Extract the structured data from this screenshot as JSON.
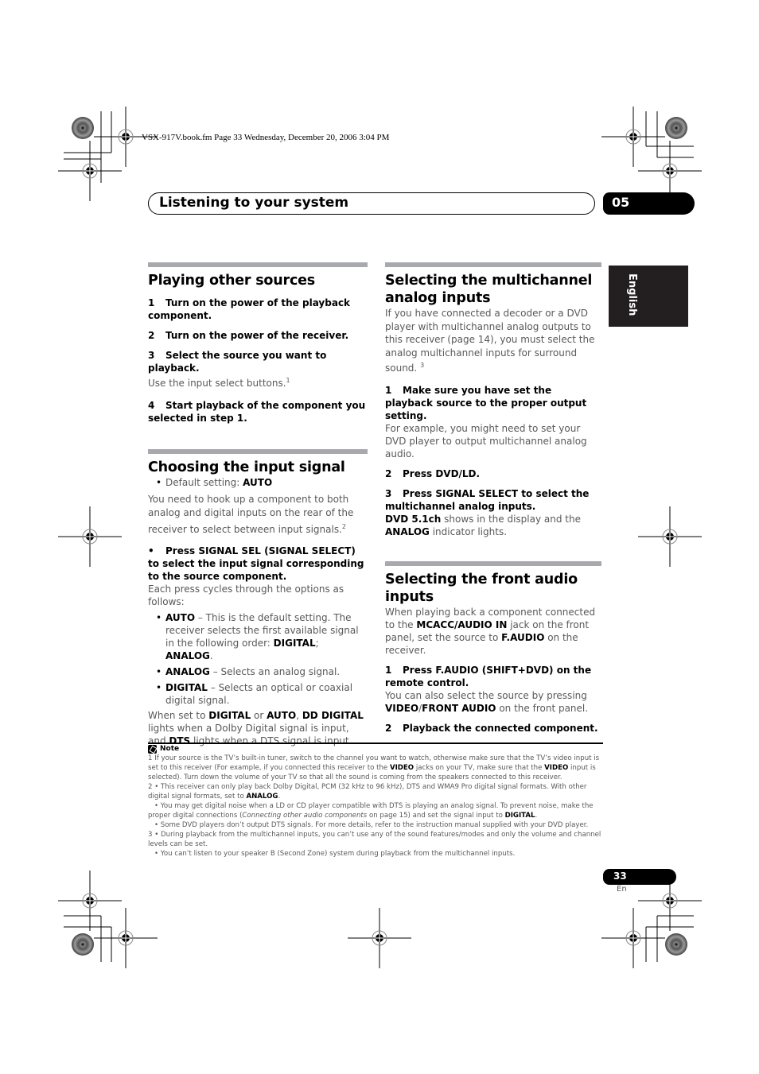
{
  "imprint": "VSX-917V.book.fm  Page 33  Wednesday, December 20, 2006  3:04 PM",
  "header": {
    "title": "Listening to your system",
    "chapter": "05"
  },
  "language_tab": "English",
  "left_column": {
    "playing": {
      "title": "Playing other sources",
      "steps": [
        {
          "n": "1",
          "text": "Turn on the power of the playback component."
        },
        {
          "n": "2",
          "text": "Turn on the power of the receiver."
        },
        {
          "n": "3",
          "text": "Select the source you want to playback."
        },
        {
          "n": "4",
          "text": "Start playback of the component you selected in step 1."
        }
      ],
      "step3_body": "Use the input select buttons.",
      "step3_footnote": "1"
    },
    "choosing": {
      "title": "Choosing the input signal",
      "default_label": "Default setting: ",
      "default_value": "AUTO",
      "intro": "You need to hook up a component to both analog and digital inputs on the rear of the receiver to select between input signals.",
      "intro_footnote": "2",
      "press_step": "Press SIGNAL SEL (SIGNAL SELECT) to select the input signal corresponding to the source component.",
      "press_body": "Each press cycles through the options as follows:",
      "options": [
        {
          "key": "AUTO",
          "text": " – This is the default setting. The receiver selects the first available signal in the following order: ",
          "order1": "DIGITAL",
          "sep": "; ",
          "order2": "ANALOG",
          "end": "."
        },
        {
          "key": "ANALOG",
          "text": " – Selects an analog signal."
        },
        {
          "key": "DIGITAL",
          "text": " – Selects an optical or coaxial digital signal."
        }
      ],
      "closing": {
        "p1": "When set to ",
        "b1": "DIGITAL",
        "p2": " or ",
        "b2": "AUTO",
        "p3": ", ",
        "b3": "DD DIGITAL",
        "p4": " lights when a Dolby Digital signal is input, and ",
        "b4": "DTS",
        "p5": " lights when a DTS signal is input."
      }
    }
  },
  "right_column": {
    "multichannel": {
      "title": "Selecting the multichannel analog inputs",
      "intro": "If you have connected a decoder or a DVD player with multichannel analog outputs to this receiver (page 14), you must select the analog multichannel inputs for surround sound. ",
      "intro_footnote": "3",
      "steps": [
        {
          "n": "1",
          "text": "Make sure you have set the playback source to the proper output setting."
        },
        {
          "n": "2",
          "text": "Press DVD/LD."
        },
        {
          "n": "3",
          "text": "Press SIGNAL SELECT to select the multichannel analog inputs."
        }
      ],
      "step1_body": "For example, you might need to set your DVD player to output multichannel analog audio.",
      "step3_body": {
        "b1": "DVD 5.1ch",
        "p1": " shows in the display and the ",
        "b2": "ANALOG",
        "p2": " indicator lights."
      }
    },
    "front_audio": {
      "title": "Selecting the front audio inputs",
      "intro": {
        "p1": "When playing back a component connected to the ",
        "b1": "MCACC/AUDIO IN",
        "p2": " jack on the front panel, set the source to ",
        "b2": "F.AUDIO",
        "p3": " on the receiver."
      },
      "steps": [
        {
          "n": "1",
          "text": "Press F.AUDIO (SHIFT+DVD) on the remote control."
        },
        {
          "n": "2",
          "text": "Playback the connected component."
        }
      ],
      "step1_body": {
        "p1": "You can also select the source by pressing ",
        "b1": "VIDEO",
        "p2": "/",
        "b2": "FRONT AUDIO",
        "p3": " on the front panel."
      }
    }
  },
  "notes": {
    "heading": "Note",
    "n1": {
      "p1": "1  If your source is the TV’s built-in tuner, switch to the channel you want to watch, otherwise make sure that the TV’s video input is set to this receiver (For example, if you connected this receiver to the ",
      "b1": "VIDEO",
      "p2": " jacks on your TV, make sure that the ",
      "b2": "VIDEO",
      "p3": " input is selected). Turn down the volume of your TV so that all the sound is coming from the speakers connected to this receiver."
    },
    "n2a": {
      "p1": "2  • This receiver can only play back Dolby Digital, PCM (32 kHz to 96 kHz), DTS and WMA9 Pro digital signal formats. With other digital signal formats, set to ",
      "b1": "ANALOG",
      "p2": "."
    },
    "n2b": {
      "p1": "• You may get digital noise when a LD or CD player compatible with DTS is playing an analog signal. To prevent noise, make the proper digital connections (",
      "i1": "Connecting other audio components",
      "p2": " on page 15) and set the signal input to ",
      "b1": "DIGITAL",
      "p3": "."
    },
    "n2c": "• Some DVD players don’t output DTS signals. For more details, refer to the instruction manual supplied with your DVD player.",
    "n3a": "3  • During playback from the multichannel inputs, you can’t use any of the sound features/modes and only the volume and channel levels can be set.",
    "n3b": "• You can’t listen to your speaker B (Second Zone) system during playback from the multichannel inputs."
  },
  "footer": {
    "page_number": "33",
    "page_lang": "En"
  }
}
